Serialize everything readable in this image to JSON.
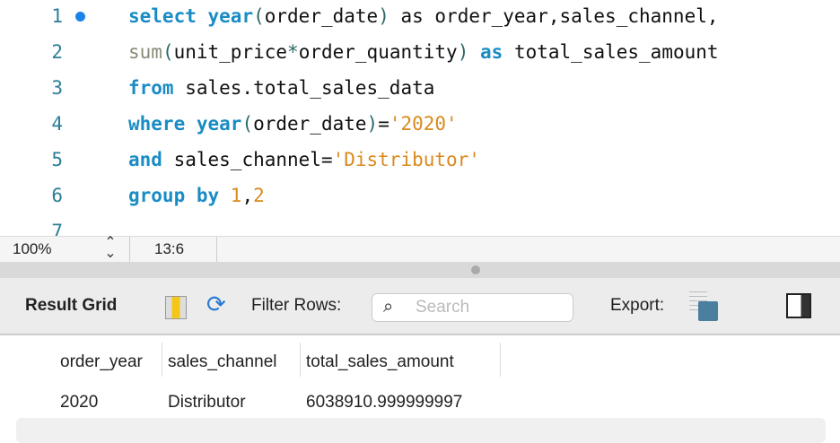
{
  "editor": {
    "lines": [
      {
        "n": "1",
        "tokens": [
          [
            "kw",
            "select "
          ],
          [
            "kw",
            "year"
          ],
          [
            "p",
            "("
          ],
          [
            "t",
            "order_date"
          ],
          [
            "p",
            ")"
          ],
          [
            "t",
            " as order_year,sales_channel,"
          ]
        ]
      },
      {
        "n": "2",
        "tokens": [
          [
            "fn",
            "sum"
          ],
          [
            "p",
            "("
          ],
          [
            "t",
            "unit_price"
          ],
          [
            "p",
            "*"
          ],
          [
            "t",
            "order_quantity"
          ],
          [
            "p",
            ")"
          ],
          [
            "t",
            " "
          ],
          [
            "kw",
            "as"
          ],
          [
            "t",
            " total_sales_amount"
          ]
        ]
      },
      {
        "n": "3",
        "tokens": [
          [
            "kw",
            "from"
          ],
          [
            "t",
            " sales.total_sales_data"
          ]
        ]
      },
      {
        "n": "4",
        "tokens": [
          [
            "kw",
            "where "
          ],
          [
            "kw",
            "year"
          ],
          [
            "p",
            "("
          ],
          [
            "t",
            "order_date"
          ],
          [
            "p",
            ")"
          ],
          [
            "t",
            "="
          ],
          [
            "str",
            "'2020'"
          ]
        ]
      },
      {
        "n": "5",
        "tokens": [
          [
            "kw",
            "and"
          ],
          [
            "t",
            " sales_channel="
          ],
          [
            "str",
            "'Distributor'"
          ]
        ]
      },
      {
        "n": "6",
        "tokens": [
          [
            "kw",
            "group by "
          ],
          [
            "num",
            "1"
          ],
          [
            "t",
            ","
          ],
          [
            "num",
            "2"
          ]
        ]
      },
      {
        "n": "7",
        "tokens": []
      }
    ]
  },
  "status": {
    "zoom": "100%",
    "cursor": "13:6"
  },
  "toolbar": {
    "result_grid": "Result Grid",
    "filter_rows": "Filter Rows:",
    "search_placeholder": "Search",
    "export": "Export:"
  },
  "grid": {
    "columns": [
      "order_year",
      "sales_channel",
      "total_sales_amount"
    ],
    "rows": [
      [
        "2020",
        "Distributor",
        "6038910.999999997"
      ]
    ]
  }
}
